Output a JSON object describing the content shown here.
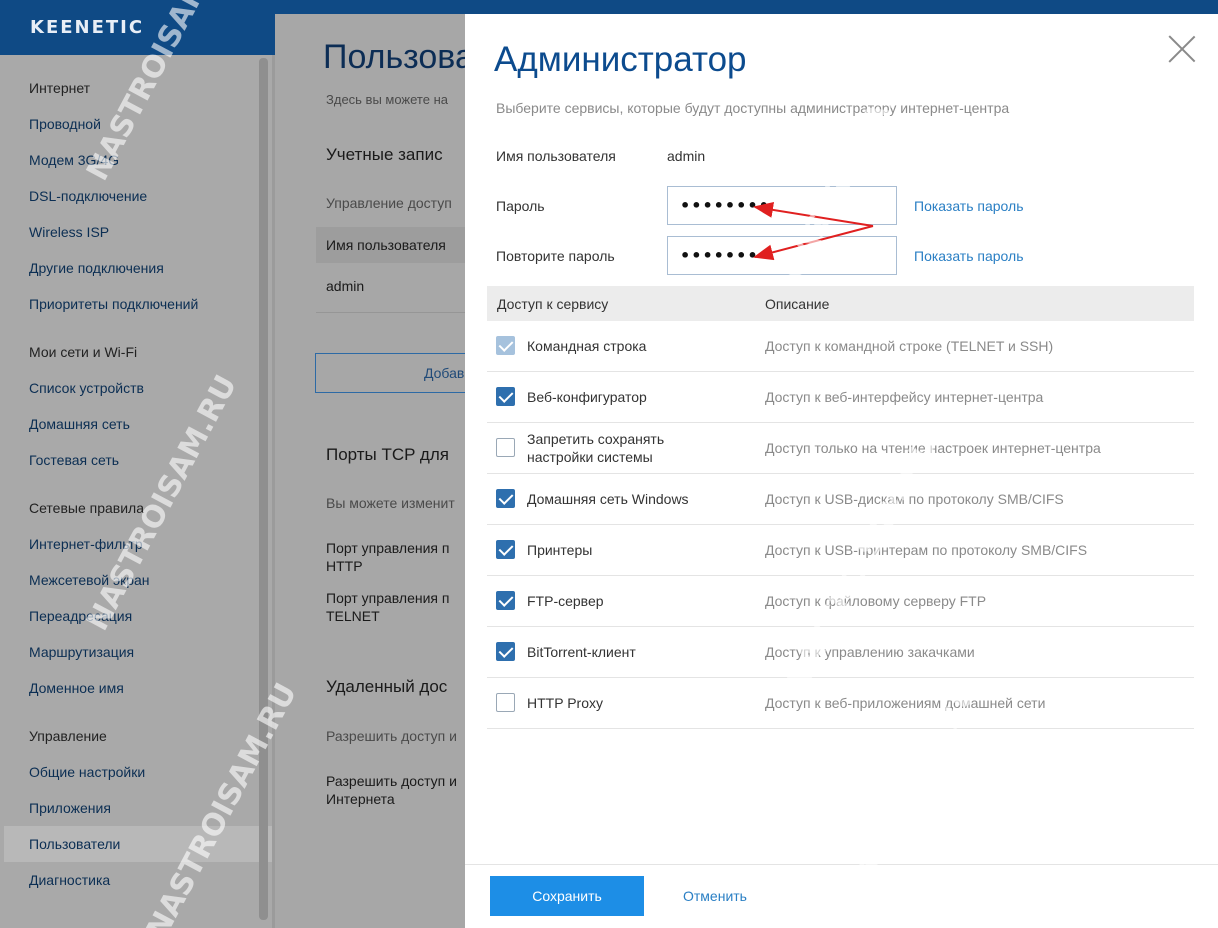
{
  "app": {
    "logo": "KEENETIC"
  },
  "sidebar": {
    "groups": [
      {
        "title": "Интернет",
        "items": [
          "Проводной",
          "Модем 3G/4G",
          "DSL-подключение",
          "Wireless ISP",
          "Другие подключения",
          "Приоритеты подключений"
        ]
      },
      {
        "title": "Мои сети и Wi-Fi",
        "items": [
          "Список устройств",
          "Домашняя сеть",
          "Гостевая сеть"
        ]
      },
      {
        "title": "Сетевые правила",
        "items": [
          "Интернет-фильтр",
          "Межсетевой экран",
          "Переадресация",
          "Маршрутизация",
          "Доменное имя"
        ]
      },
      {
        "title": "Управление",
        "items": [
          "Общие настройки",
          "Приложения",
          "Пользователи",
          "Диагностика"
        ]
      }
    ],
    "active_item": "Пользователи"
  },
  "main": {
    "title": "Пользовате",
    "desc": "Здесь вы можете на",
    "accounts_heading": "Учетные запис",
    "accounts_sub": "Управление доступ",
    "table_header": "Имя пользователя",
    "table_row": "admin",
    "add_button": "Добав",
    "ports_heading": "Порты TCP для",
    "ports_sub": "Вы можете изменит",
    "port_http": "Порт управления п\nHTTP",
    "port_telnet": "Порт управления п\nTELNET",
    "remote_heading": "Удаленный дос",
    "remote_sub": "Разрешить доступ и",
    "remote_text": "Разрешить доступ и\nИнтернета"
  },
  "modal": {
    "title": "Администратор",
    "description": "Выберите сервисы, которые будут доступны администратору интернет-центра",
    "username_label": "Имя пользователя",
    "username_value": "admin",
    "password_label": "Пароль",
    "password_value": "••••••••",
    "repeat_label": "Повторите пароль",
    "repeat_value": "••••••••",
    "show_password": "Показать пароль",
    "table": {
      "col_service": "Доступ к сервису",
      "col_desc": "Описание",
      "rows": [
        {
          "name": "Командная строка",
          "desc": "Доступ к командной строке (TELNET и SSH)",
          "checked": true,
          "disabled": true
        },
        {
          "name": "Веб-конфигуратор",
          "desc": "Доступ к веб-интерфейсу интернет-центра",
          "checked": true,
          "disabled": false
        },
        {
          "name": "Запретить сохранять настройки системы",
          "desc": "Доступ только на чтение настроек интернет-центра",
          "checked": false,
          "disabled": false
        },
        {
          "name": "Домашняя сеть Windows",
          "desc": "Доступ к USB-дискам по протоколу SMB/CIFS",
          "checked": true,
          "disabled": false
        },
        {
          "name": "Принтеры",
          "desc": "Доступ к USB-принтерам по протоколу SMB/CIFS",
          "checked": true,
          "disabled": false
        },
        {
          "name": "FTP-сервер",
          "desc": "Доступ к файловому серверу FTP",
          "checked": true,
          "disabled": false
        },
        {
          "name": "BitTorrent-клиент",
          "desc": "Доступ к управлению закачками",
          "checked": true,
          "disabled": false
        },
        {
          "name": "HTTP Proxy",
          "desc": "Доступ к веб-приложениям домашней сети",
          "checked": false,
          "disabled": false
        }
      ]
    },
    "save_button": "Сохранить",
    "cancel_button": "Отменить"
  },
  "watermark": "NASTROISAM.RU",
  "colors": {
    "brand": "#0f4a85",
    "accent": "#1d8ee6",
    "link": "#2a7fc4",
    "annotation": "#e02020"
  }
}
